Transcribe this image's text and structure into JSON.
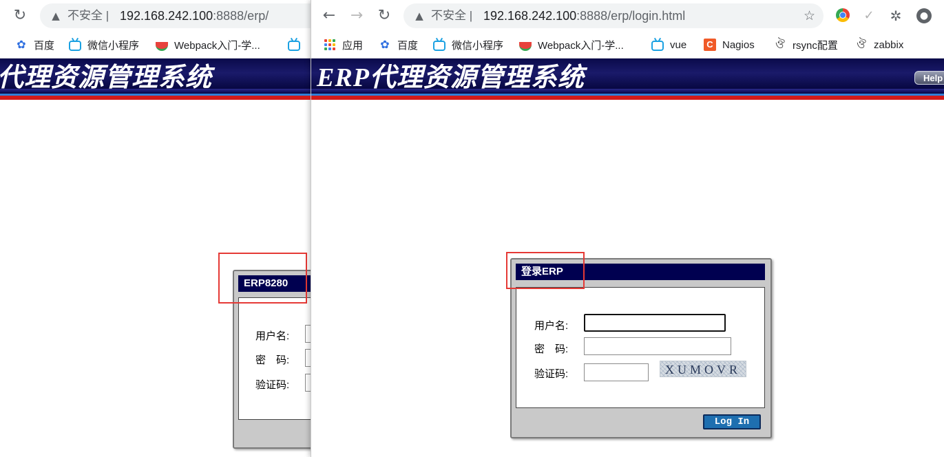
{
  "back_window": {
    "omnibox": {
      "security_label": "不安全",
      "separator": "|",
      "host": "192.168.242.100",
      "rest": ":8888/erp/"
    },
    "bookmarks": [
      {
        "label": "百度",
        "icon": "baidu-paw-icon"
      },
      {
        "label": "微信小程序",
        "icon": "bilibili-tv-icon"
      },
      {
        "label": "Webpack入门-学...",
        "icon": "watermelon-icon"
      }
    ],
    "header_title": "代理资源管理系统",
    "dialog": {
      "title": "ERP8280",
      "username_label": "用户名:",
      "password_label": "密　码:",
      "captcha_label": "验证码:"
    }
  },
  "front_window": {
    "omnibox": {
      "security_label": "不安全",
      "separator": "|",
      "host": "192.168.242.100",
      "rest": ":8888/erp/login.html"
    },
    "bookmarks": [
      {
        "label": "应用",
        "icon": "apps-grid-icon"
      },
      {
        "label": "百度",
        "icon": "baidu-paw-icon"
      },
      {
        "label": "微信小程序",
        "icon": "bilibili-tv-icon"
      },
      {
        "label": "Webpack入门-学...",
        "icon": "watermelon-icon"
      },
      {
        "label": "vue",
        "icon": "bilibili-tv-icon"
      },
      {
        "label": "Nagios",
        "icon": "nagios-c-icon"
      },
      {
        "label": "rsync配置",
        "icon": "swirl-icon"
      },
      {
        "label": "zabbix",
        "icon": "swirl-icon"
      }
    ],
    "header_title": "ERP代理资源管理系统",
    "help_label": "Help",
    "dialog": {
      "title": "登录ERP",
      "username_label": "用户名:",
      "password_label": "密　码:",
      "captcha_label": "验证码:",
      "username_value": "",
      "password_value": "",
      "captcha_value": "",
      "captcha_text": "XUMOVR",
      "login_button": "Log In"
    }
  },
  "colors": {
    "header_navy": "#0a0a4a",
    "header_red_stripe": "#d11b1b",
    "dialog_title_bg": "#000050",
    "login_button_bg": "#1e6fb0",
    "highlight_red": "#e53935"
  }
}
